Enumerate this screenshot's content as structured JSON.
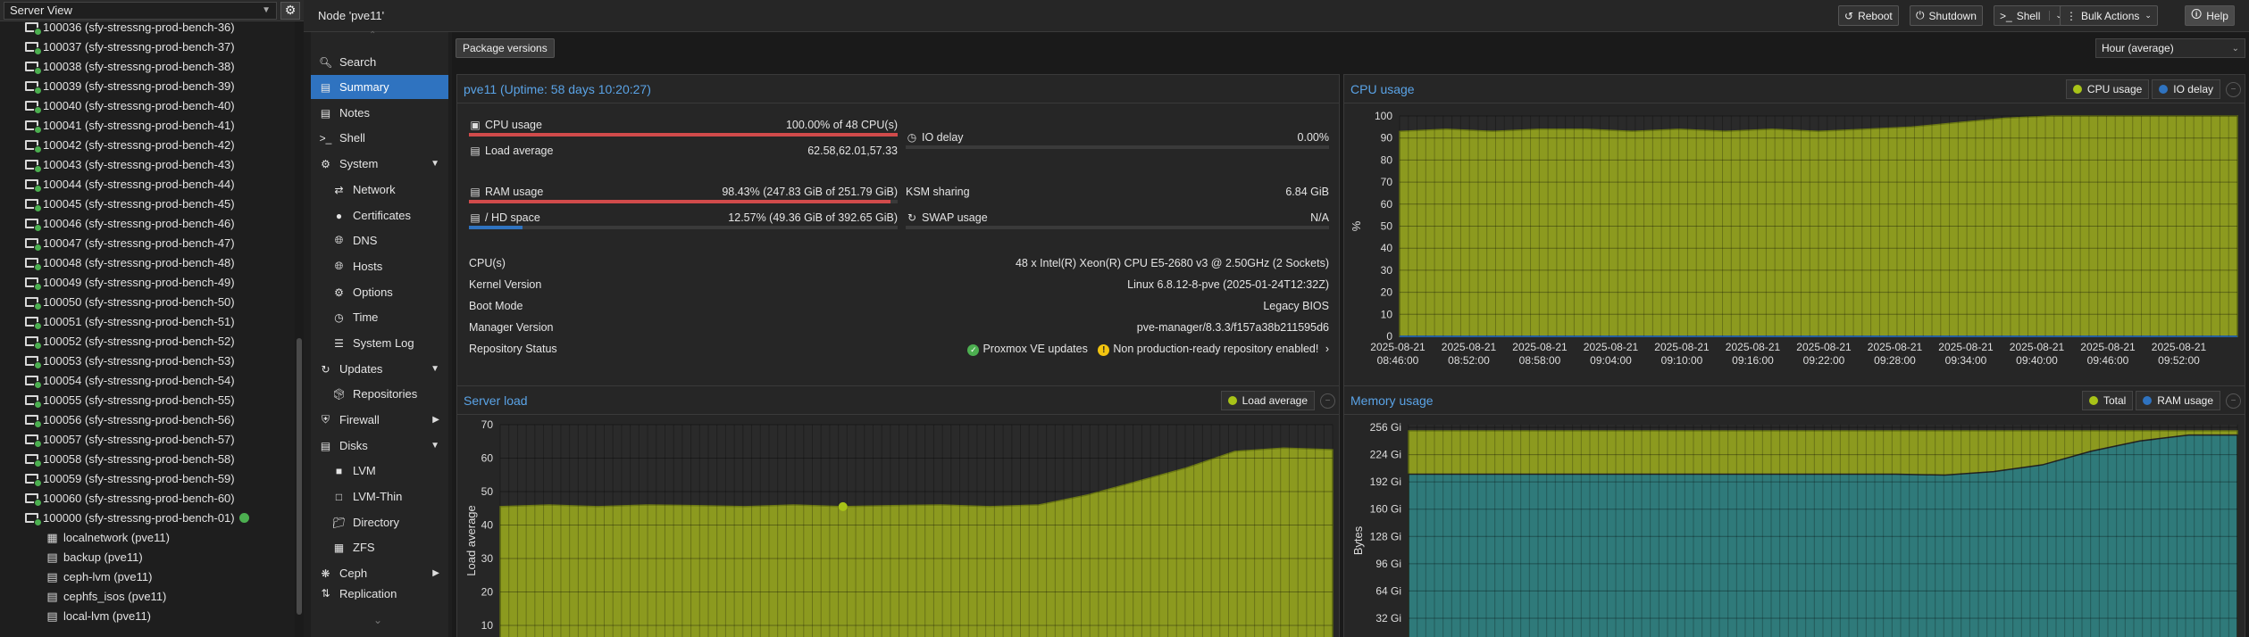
{
  "tree": {
    "view_label": "Server View",
    "vms": [
      "100036 (sfy-stressng-prod-bench-36)",
      "100037 (sfy-stressng-prod-bench-37)",
      "100038 (sfy-stressng-prod-bench-38)",
      "100039 (sfy-stressng-prod-bench-39)",
      "100040 (sfy-stressng-prod-bench-40)",
      "100041 (sfy-stressng-prod-bench-41)",
      "100042 (sfy-stressng-prod-bench-42)",
      "100043 (sfy-stressng-prod-bench-43)",
      "100044 (sfy-stressng-prod-bench-44)",
      "100045 (sfy-stressng-prod-bench-45)",
      "100046 (sfy-stressng-prod-bench-46)",
      "100047 (sfy-stressng-prod-bench-47)",
      "100048 (sfy-stressng-prod-bench-48)",
      "100049 (sfy-stressng-prod-bench-49)",
      "100050 (sfy-stressng-prod-bench-50)",
      "100051 (sfy-stressng-prod-bench-51)",
      "100052 (sfy-stressng-prod-bench-52)",
      "100053 (sfy-stressng-prod-bench-53)",
      "100054 (sfy-stressng-prod-bench-54)",
      "100055 (sfy-stressng-prod-bench-55)",
      "100056 (sfy-stressng-prod-bench-56)",
      "100057 (sfy-stressng-prod-bench-57)",
      "100058 (sfy-stressng-prod-bench-58)",
      "100059 (sfy-stressng-prod-bench-59)",
      "100060 (sfy-stressng-prod-bench-60)"
    ],
    "special_vm": "100000 (sfy-stressng-prod-bench-01)",
    "resources": [
      {
        "label": "localnetwork (pve11)",
        "icon": "grid-icon"
      },
      {
        "label": "backup (pve11)",
        "icon": "storage-icon"
      },
      {
        "label": "ceph-lvm (pve11)",
        "icon": "storage-icon"
      },
      {
        "label": "cephfs_isos (pve11)",
        "icon": "storage-icon"
      },
      {
        "label": "local-lvm (pve11)",
        "icon": "storage-icon"
      }
    ]
  },
  "topbar": {
    "node_title": "Node 'pve11'",
    "reboot": "Reboot",
    "shutdown": "Shutdown",
    "shell": "Shell",
    "bulk": "Bulk Actions",
    "help": "Help"
  },
  "nav": {
    "search": "Search",
    "summary": "Summary",
    "notes": "Notes",
    "shell": "Shell",
    "system": "System",
    "network": "Network",
    "certificates": "Certificates",
    "dns": "DNS",
    "hosts": "Hosts",
    "options": "Options",
    "time": "Time",
    "syslog": "System Log",
    "updates": "Updates",
    "repositories": "Repositories",
    "firewall": "Firewall",
    "disks": "Disks",
    "lvm": "LVM",
    "lvmthin": "LVM-Thin",
    "directory": "Directory",
    "zfs": "ZFS",
    "ceph": "Ceph",
    "replication": "Replication"
  },
  "main": {
    "package_versions": "Package versions",
    "timeframe": "Hour (average)"
  },
  "status": {
    "title": "pve11 (Uptime: 58 days 10:20:27)",
    "cpu_label": "CPU usage",
    "cpu_value": "100.00% of 48 CPU(s)",
    "cpu_fraction": 1.0,
    "load_label": "Load average",
    "load_value": "62.58,62.01,57.33",
    "io_label": "IO delay",
    "io_value": "0.00%",
    "io_fraction": 0.0,
    "ram_label": "RAM usage",
    "ram_value": "98.43% (247.83 GiB of 251.79 GiB)",
    "ram_fraction": 0.9843,
    "ksm_label": "KSM sharing",
    "ksm_value": "6.84 GiB",
    "hd_label": "/ HD space",
    "hd_value": "12.57% (49.36 GiB of 392.65 GiB)",
    "hd_fraction": 0.1257,
    "swap_label": "SWAP usage",
    "swap_value": "N/A",
    "swap_fraction": 0.0,
    "cpus_label": "CPU(s)",
    "cpus_value": "48 x Intel(R) Xeon(R) CPU E5-2680 v3 @ 2.50GHz (2 Sockets)",
    "kernel_label": "Kernel Version",
    "kernel_value": "Linux 6.8.12-8-pve (2025-01-24T12:32Z)",
    "boot_label": "Boot Mode",
    "boot_value": "Legacy BIOS",
    "manager_label": "Manager Version",
    "manager_value": "pve-manager/8.3.3/f157a38b211595d6",
    "repo_label": "Repository Status",
    "repo_ok": "Proxmox VE updates",
    "repo_warn": "Non production-ready repository enabled!"
  },
  "colors": {
    "accent": "#2f73c0",
    "title_blue": "#5aa3e6",
    "danger_bar": "#d14b4b",
    "ok_bar": "#2f73c0",
    "area_olive": "#8c9a1f",
    "area_teal": "#2f7a7a",
    "legend_green": "#a8c318",
    "legend_blue": "#2f73c0"
  },
  "chart_data": [
    {
      "type": "area",
      "title": "CPU usage",
      "ylabel": "%",
      "ylim": [
        0,
        100
      ],
      "yticks": [
        0,
        10,
        20,
        30,
        40,
        50,
        60,
        70,
        80,
        90,
        100
      ],
      "xlim": [
        "2025-08-21 08:46:00",
        "2025-08-21 09:52:00"
      ],
      "xtick_dates": [
        "2025-08-21",
        "2025-08-21",
        "2025-08-21",
        "2025-08-21",
        "2025-08-21",
        "2025-08-21",
        "2025-08-21",
        "2025-08-21",
        "2025-08-21",
        "2025-08-21",
        "2025-08-21",
        "2025-08-21"
      ],
      "xtick_times": [
        "08:46:00",
        "08:52:00",
        "08:58:00",
        "09:04:00",
        "09:10:00",
        "09:16:00",
        "09:22:00",
        "09:28:00",
        "09:34:00",
        "09:40:00",
        "09:46:00",
        "09:52:00"
      ],
      "legend": [
        "CPU usage",
        "IO delay"
      ],
      "x": [
        "08:46",
        "08:50",
        "08:54",
        "08:58",
        "09:02",
        "09:06",
        "09:10",
        "09:14",
        "09:18",
        "09:22",
        "09:26",
        "09:30",
        "09:32",
        "09:34",
        "09:38",
        "09:42",
        "09:46",
        "09:50",
        "09:52"
      ],
      "series": [
        {
          "name": "CPU usage",
          "values": [
            93,
            94,
            93,
            94,
            94,
            93,
            94,
            93,
            94,
            93,
            94,
            95,
            97,
            99,
            100,
            100,
            100,
            100,
            100
          ]
        },
        {
          "name": "IO delay",
          "values": [
            0,
            0,
            0,
            0,
            0,
            0,
            0,
            0,
            0,
            0,
            0,
            0,
            0,
            0,
            0,
            0,
            0,
            0,
            0
          ]
        }
      ]
    },
    {
      "type": "area",
      "title": "Server load",
      "ylabel": "Load average",
      "yticks": [
        10,
        20,
        30,
        40,
        50,
        60,
        70
      ],
      "legend": [
        "Load average"
      ],
      "x": [
        "08:46",
        "08:50",
        "08:54",
        "08:58",
        "09:02",
        "09:06",
        "09:10",
        "09:14",
        "09:18",
        "09:22",
        "09:26",
        "09:30",
        "09:34",
        "09:38",
        "09:42",
        "09:46",
        "09:48",
        "09:52"
      ],
      "series": [
        {
          "name": "Load average",
          "values": [
            45.5,
            46,
            45.5,
            46,
            45.8,
            45.5,
            46,
            45.5,
            45.8,
            46,
            45.5,
            46,
            49,
            53,
            57,
            62,
            63,
            62.5
          ]
        }
      ]
    },
    {
      "type": "area",
      "title": "Memory usage",
      "ylabel": "Bytes",
      "yticks": [
        "32 Gi",
        "64 Gi",
        "96 Gi",
        "128 Gi",
        "160 Gi",
        "192 Gi",
        "224 Gi",
        "256 Gi"
      ],
      "legend": [
        "Total",
        "RAM usage"
      ],
      "x": [
        "08:46",
        "08:50",
        "08:54",
        "08:58",
        "09:02",
        "09:06",
        "09:10",
        "09:14",
        "09:18",
        "09:22",
        "09:26",
        "09:30",
        "09:34",
        "09:38",
        "09:42",
        "09:46",
        "09:48",
        "09:52"
      ],
      "series": [
        {
          "name": "Total",
          "values": [
            251.8,
            251.8,
            251.8,
            251.8,
            251.8,
            251.8,
            251.8,
            251.8,
            251.8,
            251.8,
            251.8,
            251.8,
            251.8,
            251.8,
            251.8,
            251.8,
            251.8,
            251.8
          ]
        },
        {
          "name": "RAM usage",
          "values": [
            201,
            201,
            201,
            201,
            201,
            201,
            201,
            201,
            201,
            201,
            201,
            200,
            204,
            212,
            228,
            240,
            247,
            247
          ]
        }
      ]
    }
  ]
}
